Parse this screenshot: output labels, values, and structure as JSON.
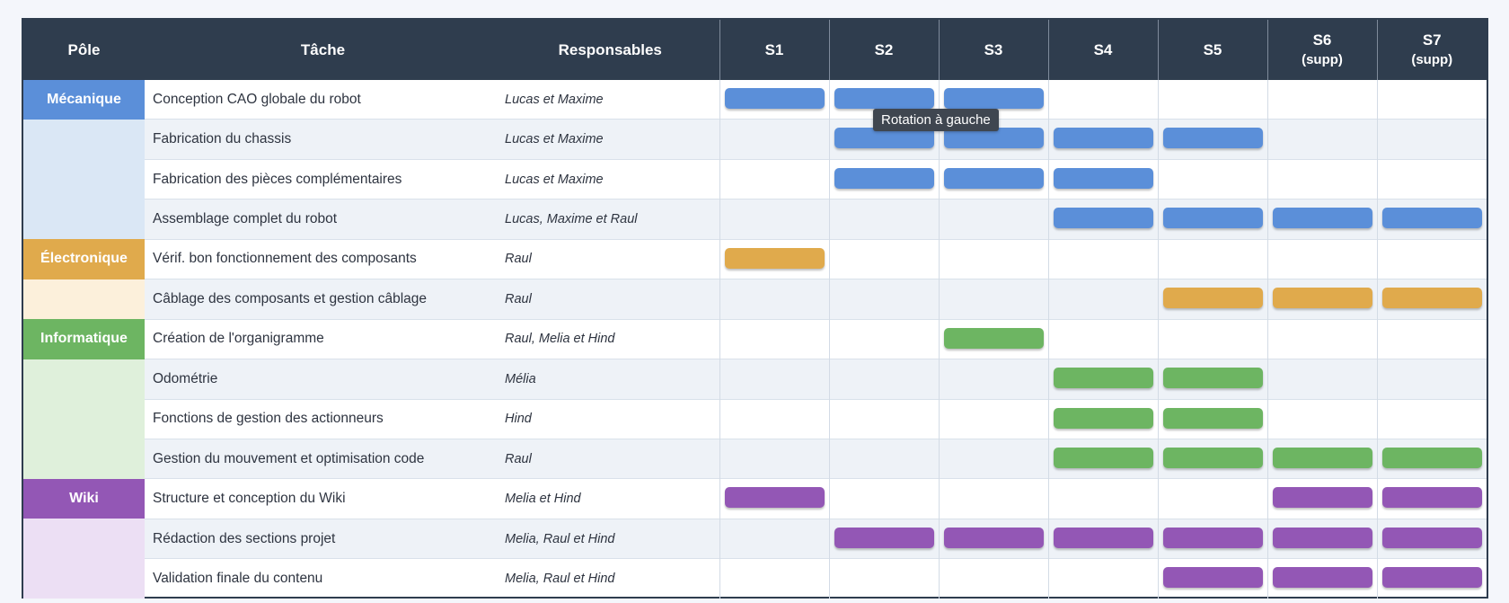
{
  "header": {
    "pole": "Pôle",
    "tache": "Tâche",
    "responsables": "Responsables",
    "weeks": [
      {
        "label": "S1",
        "sub": ""
      },
      {
        "label": "S2",
        "sub": ""
      },
      {
        "label": "S3",
        "sub": ""
      },
      {
        "label": "S4",
        "sub": ""
      },
      {
        "label": "S5",
        "sub": ""
      },
      {
        "label": "S6",
        "sub": "(supp)"
      },
      {
        "label": "S7",
        "sub": "(supp)"
      }
    ]
  },
  "poles": [
    {
      "name": "Mécanique",
      "color": "#5b8fd9",
      "light": "#dae7f5",
      "rows": 4
    },
    {
      "name": "Électronique",
      "color": "#e0aa4c",
      "light": "#fcf0db",
      "rows": 2
    },
    {
      "name": "Informatique",
      "color": "#6db562",
      "light": "#dff0db",
      "rows": 4
    },
    {
      "name": "Wiki",
      "color": "#9357b5",
      "light": "#ecdff4",
      "rows": 3
    }
  ],
  "tasks": [
    {
      "pole": 0,
      "task": "Conception CAO globale du robot",
      "resp": "Lucas et Maxime",
      "weeks": [
        1,
        1,
        1,
        0,
        0,
        0,
        0
      ]
    },
    {
      "pole": 0,
      "task": "Fabrication du chassis",
      "resp": "Lucas et Maxime",
      "weeks": [
        0,
        1,
        1,
        1,
        1,
        0,
        0
      ]
    },
    {
      "pole": 0,
      "task": "Fabrication des pièces complémentaires",
      "resp": "Lucas et Maxime",
      "weeks": [
        0,
        1,
        1,
        1,
        0,
        0,
        0
      ]
    },
    {
      "pole": 0,
      "task": "Assemblage complet du robot",
      "resp": "Lucas, Maxime et Raul",
      "weeks": [
        0,
        0,
        0,
        1,
        1,
        1,
        1
      ]
    },
    {
      "pole": 1,
      "task": "Vérif. bon fonctionnement des composants",
      "resp": "Raul",
      "weeks": [
        1,
        0,
        0,
        0,
        0,
        0,
        0
      ]
    },
    {
      "pole": 1,
      "task": "Câblage des composants et gestion câblage",
      "resp": "Raul",
      "weeks": [
        0,
        0,
        0,
        0,
        1,
        1,
        1
      ]
    },
    {
      "pole": 2,
      "task": "Création de l'organigramme",
      "resp": "Raul, Melia et Hind",
      "weeks": [
        0,
        0,
        1,
        0,
        0,
        0,
        0
      ]
    },
    {
      "pole": 2,
      "task": "Odométrie",
      "resp": "Mélia",
      "weeks": [
        0,
        0,
        0,
        1,
        1,
        0,
        0
      ]
    },
    {
      "pole": 2,
      "task": "Fonctions de gestion des actionneurs",
      "resp": "Hind",
      "weeks": [
        0,
        0,
        0,
        1,
        1,
        0,
        0
      ]
    },
    {
      "pole": 2,
      "task": "Gestion du mouvement et optimisation code",
      "resp": "Raul",
      "weeks": [
        0,
        0,
        0,
        1,
        1,
        1,
        1
      ]
    },
    {
      "pole": 3,
      "task": "Structure et conception du Wiki",
      "resp": "Melia et Hind",
      "weeks": [
        1,
        0,
        0,
        0,
        0,
        1,
        1
      ]
    },
    {
      "pole": 3,
      "task": "Rédaction des sections projet",
      "resp": "Melia, Raul et Hind",
      "weeks": [
        0,
        1,
        1,
        1,
        1,
        1,
        1
      ]
    },
    {
      "pole": 3,
      "task": "Validation finale du contenu",
      "resp": "Melia, Raul et Hind",
      "weeks": [
        0,
        0,
        0,
        0,
        1,
        1,
        1
      ]
    }
  ],
  "tooltip": "Rotation à gauche"
}
